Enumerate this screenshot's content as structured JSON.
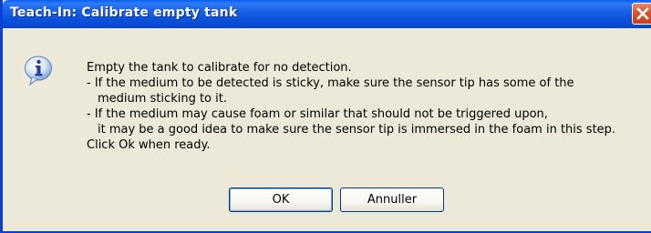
{
  "window": {
    "title": "Teach-In: Calibrate empty tank",
    "close_icon": "close-icon"
  },
  "dialog": {
    "icon": "info-icon",
    "message_lines": [
      "Empty the tank to calibrate for no detection.",
      "- If the medium to be detected is sticky, make sure the sensor tip has some of the",
      "medium sticking to it.",
      "- If the medium may cause foam or similar that should not be triggered upon,",
      "it may be a good idea to make sure the sensor tip is immersed in the foam in this step.",
      "Click Ok when ready."
    ]
  },
  "buttons": {
    "ok_label": "OK",
    "cancel_label": "Annuller"
  },
  "colors": {
    "titlebar": "#0A51DA",
    "background": "#ECE9D8",
    "close_button": "#D9532F"
  }
}
